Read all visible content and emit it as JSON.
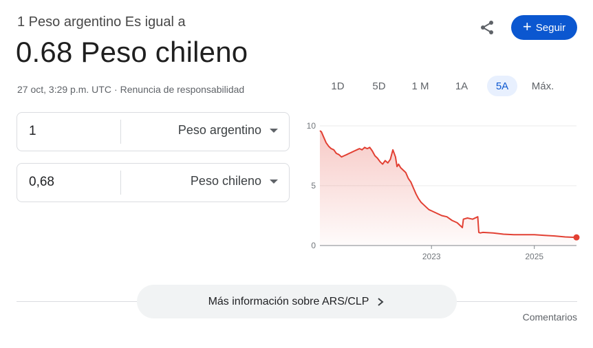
{
  "header": {
    "subtitle": "1 Peso argentino Es igual a",
    "value": "0.68 Peso chileno",
    "timestamp": "27 oct, 3:29 p.m. UTC",
    "separator": "·",
    "disclaimer": "Renuncia de responsabilidad"
  },
  "actions": {
    "share_icon": "share-icon",
    "follow_label": "Seguir",
    "follow_icon": "+"
  },
  "converter": {
    "from": {
      "amount": "1",
      "currency": "Peso argentino"
    },
    "to": {
      "amount": "0,68",
      "currency": "Peso chileno"
    }
  },
  "range_tabs": {
    "items": [
      "1D",
      "5D",
      "1 M",
      "1A",
      "5A",
      "Máx."
    ],
    "active": "5A"
  },
  "chart_data": {
    "type": "line",
    "yticks": [
      "10",
      "5",
      "0"
    ],
    "xticks": [
      "2023",
      "2025"
    ],
    "ylim": [
      0,
      10
    ],
    "x_range": [
      2020.83,
      2025.82
    ],
    "grid": true,
    "line_color": "#e24033",
    "series": [
      {
        "x": [
          2020.83,
          2020.86,
          2020.9,
          2020.95,
          2021.0,
          2021.05,
          2021.1,
          2021.15,
          2021.2,
          2021.25,
          2021.3,
          2021.35,
          2021.4,
          2021.45,
          2021.5,
          2021.55,
          2021.6,
          2021.65,
          2021.7,
          2021.75,
          2021.8,
          2021.85,
          2021.9,
          2021.95,
          2022.0,
          2022.05,
          2022.1,
          2022.15,
          2022.2,
          2022.25,
          2022.3,
          2022.33,
          2022.36,
          2022.4,
          2022.45,
          2022.5,
          2022.55,
          2022.6,
          2022.65,
          2022.7,
          2022.75,
          2022.8,
          2022.85,
          2022.9,
          2022.95,
          2023.0,
          2023.1,
          2023.2,
          2023.3,
          2023.4,
          2023.5,
          2023.6,
          2023.62,
          2023.7,
          2023.8,
          2023.9,
          2023.92,
          2023.95,
          2024.0,
          2024.2,
          2024.4,
          2024.6,
          2024.8,
          2025.0,
          2025.2,
          2025.4,
          2025.6,
          2025.82
        ],
        "values": [
          9.6,
          9.5,
          9.1,
          8.6,
          8.3,
          8.1,
          8.0,
          7.7,
          7.6,
          7.4,
          7.5,
          7.6,
          7.7,
          7.8,
          7.9,
          8.0,
          8.1,
          8.0,
          8.2,
          8.1,
          8.2,
          7.9,
          7.5,
          7.3,
          7.0,
          6.8,
          7.1,
          6.9,
          7.2,
          8.0,
          7.4,
          6.6,
          6.8,
          6.5,
          6.3,
          6.1,
          5.6,
          5.3,
          4.8,
          4.3,
          3.9,
          3.6,
          3.4,
          3.2,
          3.0,
          2.9,
          2.7,
          2.5,
          2.4,
          2.1,
          1.9,
          1.5,
          2.2,
          2.3,
          2.2,
          2.4,
          1.1,
          1.05,
          1.1,
          1.05,
          0.95,
          0.9,
          0.9,
          0.9,
          0.85,
          0.8,
          0.72,
          0.68
        ]
      }
    ]
  },
  "footer": {
    "more_info": "Más información sobre ARS/CLP",
    "comments": "Comentarios"
  }
}
